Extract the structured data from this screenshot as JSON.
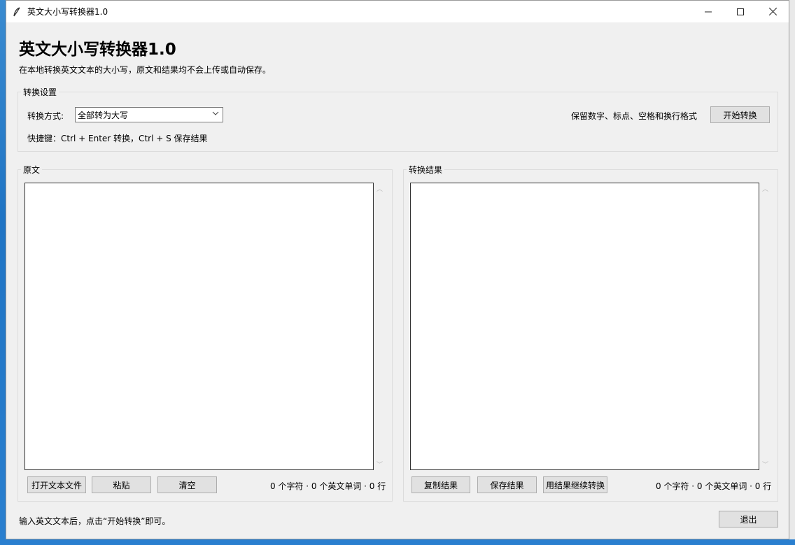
{
  "window": {
    "title": "英文大小写转换器1.0",
    "controls": {
      "minimize": "—",
      "maximize": "☐",
      "close": "✕"
    }
  },
  "header": {
    "title": "英文大小写转换器1.0",
    "subtitle": "在本地转换英文文本的大小写，原文和结果均不会上传或自动保存。"
  },
  "settings": {
    "group_label": "转换设置",
    "mode_label": "转换方式:",
    "mode_value": "全部转为大写",
    "preserve_note": "保留数字、标点、空格和换行格式",
    "convert_button": "开始转换",
    "shortcut_hint": "快捷键：Ctrl + Enter 转换，Ctrl + S 保存结果"
  },
  "source": {
    "group_label": "原文",
    "text": "",
    "open_button": "打开文本文件",
    "paste_button": "粘贴",
    "clear_button": "清空",
    "stats": "0 个字符 · 0 个英文单词 · 0 行"
  },
  "result": {
    "group_label": "转换结果",
    "text": "",
    "copy_button": "复制结果",
    "save_button": "保存结果",
    "continue_button": "用结果继续转换",
    "stats": "0 个字符 · 0 个英文单词 · 0 行"
  },
  "footer": {
    "status": "输入英文文本后，点击“开始转换”即可。",
    "exit_button": "退出"
  },
  "icons": {
    "app": "feather-icon",
    "combo_caret": "chevron-down-icon",
    "scroll_up": "scroll-up-arrow",
    "scroll_down": "scroll-down-arrow"
  }
}
